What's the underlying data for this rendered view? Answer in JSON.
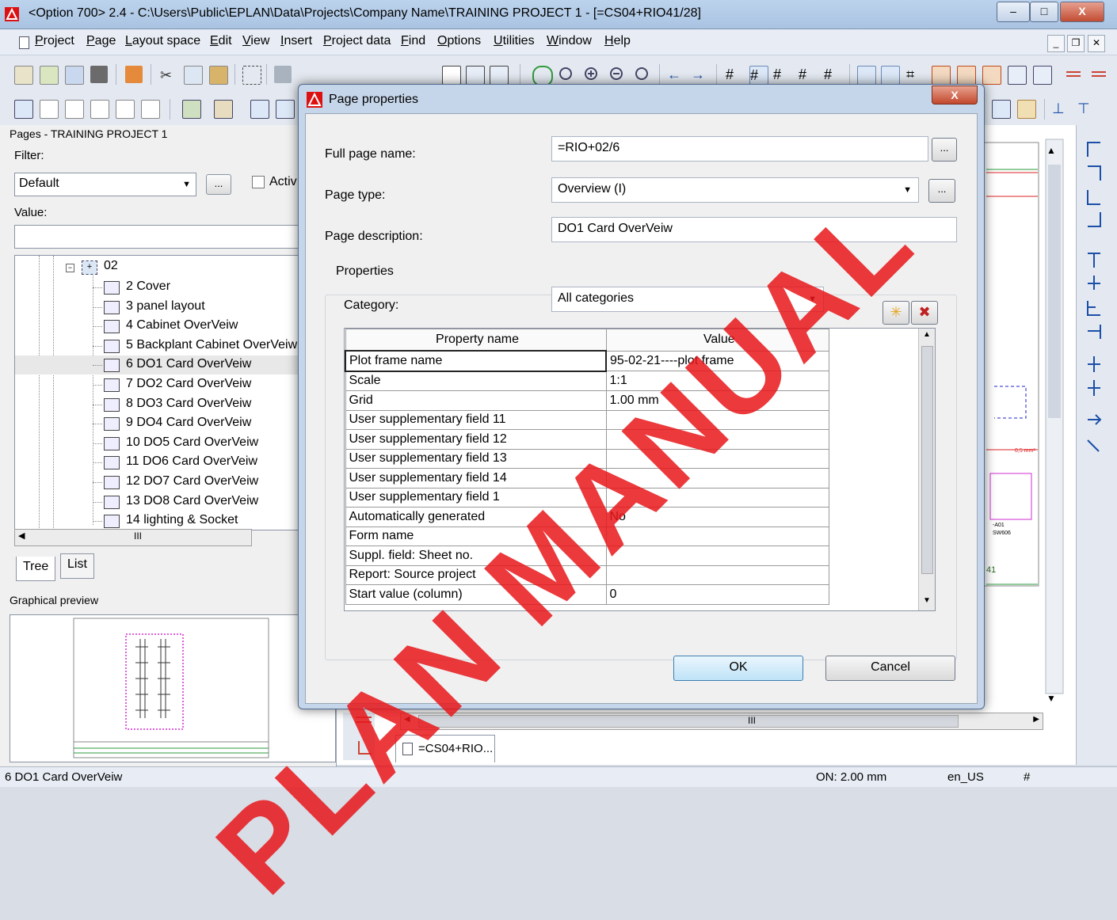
{
  "window": {
    "title": "<Option 700> 2.4 - C:\\Users\\Public\\EPLAN\\Data\\Projects\\Company Name\\TRAINING PROJECT 1 - [=CS04+RIO41/28]",
    "min": "–",
    "max": "□",
    "close": "X"
  },
  "menu": [
    "Project",
    "Page",
    "Layout space",
    "Edit",
    "View",
    "Insert",
    "Project data",
    "Find",
    "Options",
    "Utilities",
    "Window",
    "Help"
  ],
  "pages_panel": {
    "title": "Pages - TRAINING PROJECT 1",
    "filter_label": "Filter:",
    "filter_value": "Default",
    "filter_more": "...",
    "active_label": "Activ",
    "value_label": "Value:",
    "node": "02",
    "pages": [
      "2 Cover",
      "3 panel layout",
      "4 Cabinet OverVeiw",
      "5 Backplant Cabinet OverVeiw",
      "6 DO1 Card OverVeiw",
      "7 DO2 Card OverVeiw",
      "8 DO3 Card OverVeiw",
      "9 DO4 Card OverVeiw",
      "10 DO5 Card OverVeiw",
      "11 DO6 Card OverVeiw",
      "12 DO7 Card OverVeiw",
      "13 DO8 Card OverVeiw",
      "14 lighting & Socket"
    ],
    "selected_index": 4,
    "tabs": [
      "Tree",
      "List"
    ],
    "scroll_mark": "III"
  },
  "preview": {
    "title": "Graphical preview"
  },
  "document_tab": "=CS04+RIO...",
  "canvas_scroll_mark": "III",
  "canvas_labels": [
    "41",
    "0,5 mm²",
    "-A01",
    "SW606"
  ],
  "status": {
    "left": "6 DO1 Card OverVeiw",
    "on": "ON: 2.00 mm",
    "locale": "en_US",
    "hash": "#"
  },
  "dialog": {
    "title": "Page properties",
    "full_page_name_label": "Full page name:",
    "full_page_name": "=RIO+02/6",
    "page_type_label": "Page type:",
    "page_type": "Overview (I)",
    "page_description_label": "Page description:",
    "page_description": "DO1 Card OverVeiw",
    "properties_group": "Properties",
    "category_label": "Category:",
    "category": "All categories",
    "more": "...",
    "grid_headers": [
      "Property name",
      "Value"
    ],
    "rows": [
      {
        "name": "Plot frame name",
        "value": "95-02-21----plot frame"
      },
      {
        "name": "Scale",
        "value": "1:1"
      },
      {
        "name": "Grid",
        "value": "1.00 mm"
      },
      {
        "name": "User supplementary field 11",
        "value": ""
      },
      {
        "name": "User supplementary field 12",
        "value": ""
      },
      {
        "name": "User supplementary field 13",
        "value": ""
      },
      {
        "name": "User supplementary field 14",
        "value": ""
      },
      {
        "name": "User supplementary field 1",
        "value": ""
      },
      {
        "name": "Automatically generated",
        "value": "No"
      },
      {
        "name": "Form name",
        "value": ""
      },
      {
        "name": "Suppl. field: Sheet no.",
        "value": ""
      },
      {
        "name": "Report: Source project",
        "value": ""
      },
      {
        "name": "Start value (column)",
        "value": "0"
      }
    ],
    "ok": "OK",
    "cancel": "Cancel"
  },
  "watermark": "PLAN MANUAL",
  "colors": {
    "watermark": "#e8171b",
    "title_bg": "#bcd3ec",
    "dialog_frame": "#c6d6ea"
  }
}
